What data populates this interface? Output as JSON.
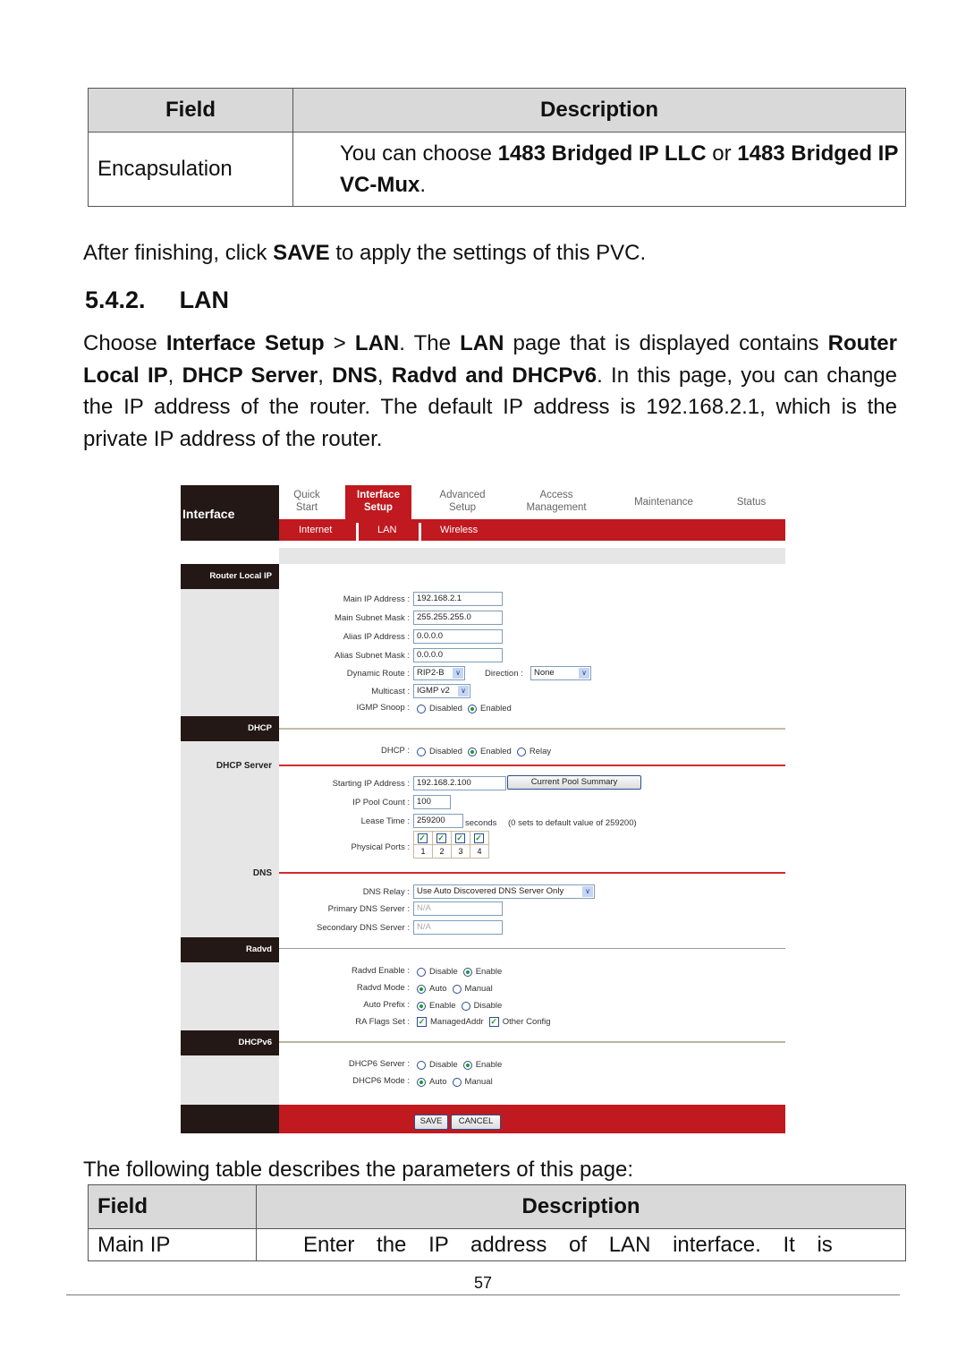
{
  "top_table": {
    "headers": [
      "Field",
      "Description"
    ],
    "rows": [
      {
        "field": "Encapsulation",
        "desc_prefix": "You can choose ",
        "opt1": "1483 Bridged IP LLC",
        "desc_mid": " or ",
        "opt2": "1483 Bridged IP VC-Mux",
        "desc_suffix": "."
      }
    ]
  },
  "after_text": {
    "prefix": "After finishing, click ",
    "bold": "SAVE",
    "suffix": " to apply the settings of this PVC."
  },
  "section": {
    "number": "5.4.2.",
    "title": "LAN"
  },
  "intro": {
    "t1": "Choose ",
    "b1": "Interface Setup",
    "t2": " > ",
    "b2": "LAN",
    "t3": ". The ",
    "b3": "LAN",
    "t4": " page that is displayed contains ",
    "b4": "Router Local IP",
    "t5": ", ",
    "b5": "DHCP Server",
    "t6": ", ",
    "b6": "DNS",
    "t7": ", ",
    "b7": "Radvd and DHCPv6",
    "t8": ". In this page, you can change the IP address of the router. The default IP address is 192.168.2.1, which is the private IP address of the router."
  },
  "router": {
    "logo": "Interface",
    "nav": [
      {
        "l1": "Quick",
        "l2": "Start"
      },
      {
        "l1": "Interface",
        "l2": "Setup",
        "active": true
      },
      {
        "l1": "Advanced",
        "l2": "Setup"
      },
      {
        "l1": "Access",
        "l2": "Management"
      },
      {
        "l1": "Maintenance",
        "l2": ""
      },
      {
        "l1": "Status",
        "l2": ""
      }
    ],
    "subnav": [
      "Internet",
      "LAN",
      "Wireless"
    ],
    "sections": {
      "router_local_ip": "Router Local IP",
      "dhcp": "DHCP",
      "dhcp_server": "DHCP Server",
      "dns": "DNS",
      "radvd": "Radvd",
      "dhcpv6": "DHCPv6"
    },
    "fields": {
      "main_ip_label": "Main IP Address :",
      "main_ip": "192.168.2.1",
      "main_mask_label": "Main Subnet Mask :",
      "main_mask": "255.255.255.0",
      "alias_ip_label": "Alias IP Address :",
      "alias_ip": "0.0.0.0",
      "alias_mask_label": "Alias Subnet Mask :",
      "alias_mask": "0.0.0.0",
      "dyn_route_label": "Dynamic Route :",
      "dyn_route": "RIP2-B",
      "direction_label": "Direction :",
      "direction": "None",
      "multicast_label": "Multicast :",
      "multicast": "IGMP v2",
      "igmp_label": "IGMP Snoop :",
      "igmp_opts": [
        "Disabled",
        "Enabled"
      ],
      "igmp_selected": "Enabled",
      "dhcp_label": "DHCP :",
      "dhcp_opts": [
        "Disabled",
        "Enabled",
        "Relay"
      ],
      "dhcp_selected": "Enabled",
      "start_ip_label": "Starting IP Address :",
      "start_ip": "192.168.2.100",
      "pool_summary_btn": "Current Pool Summary",
      "pool_count_label": "IP Pool Count :",
      "pool_count": "100",
      "lease_label": "Lease Time :",
      "lease": "259200",
      "lease_unit": "seconds",
      "lease_note": "(0 sets to default value of 259200)",
      "ports_label": "Physical Ports :",
      "ports": [
        "1",
        "2",
        "3",
        "4"
      ],
      "ports_checked": [
        true,
        true,
        true,
        true
      ],
      "dns_relay_label": "DNS Relay :",
      "dns_relay": "Use Auto Discovered DNS Server Only",
      "primary_dns_label": "Primary DNS Server :",
      "primary_dns": "N/A",
      "secondary_dns_label": "Secondary DNS Server :",
      "secondary_dns": "N/A",
      "radvd_enable_label": "Radvd Enable :",
      "radvd_enable_opts": [
        "Disable",
        "Enable"
      ],
      "radvd_enable_selected": "Enable",
      "radvd_mode_label": "Radvd Mode :",
      "radvd_mode_opts": [
        "Auto",
        "Manual"
      ],
      "radvd_mode_selected": "Auto",
      "auto_prefix_label": "Auto Prefix :",
      "auto_prefix_opts": [
        "Enable",
        "Disable"
      ],
      "auto_prefix_selected": "Enable",
      "ra_flags_label": "RA Flags Set :",
      "ra_flags": [
        "ManagedAddr",
        "Other Config"
      ],
      "ra_flags_checked": [
        true,
        true
      ],
      "dhcp6_server_label": "DHCP6 Server :",
      "dhcp6_server_opts": [
        "Disable",
        "Enable"
      ],
      "dhcp6_server_selected": "Enable",
      "dhcp6_mode_label": "DHCP6 Mode :",
      "dhcp6_mode_opts": [
        "Auto",
        "Manual"
      ],
      "dhcp6_mode_selected": "Auto"
    },
    "buttons": {
      "save": "SAVE",
      "cancel": "CANCEL"
    },
    "colors": {
      "brand_red": "#c0191f",
      "dark": "#231815",
      "sidebar_grey": "#e6e6e6"
    }
  },
  "following_text": "The following table describes the parameters of this page:",
  "bottom_table": {
    "headers": [
      "Field",
      "Description"
    ],
    "rows": [
      {
        "field": "Main IP",
        "desc": "Enter the IP address of LAN interface. It is"
      }
    ]
  },
  "page_number": "57"
}
